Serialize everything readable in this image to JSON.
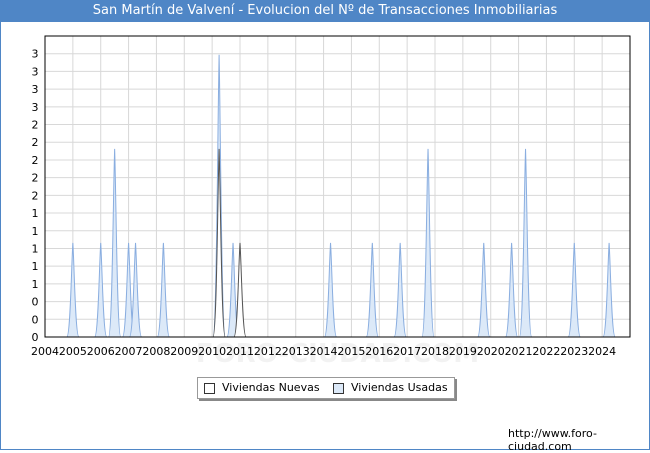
{
  "title": "San Martín de Valvení - Evolucion del Nº de Transacciones Inmobiliarias",
  "source": "http://www.foro-ciudad.com",
  "watermark": "FORO-CIUDAD.COM",
  "legend": [
    {
      "label": "Viviendas Nuevas",
      "color": "#ffffff"
    },
    {
      "label": "Viviendas Usadas",
      "color": "#dce9f8"
    }
  ],
  "chart_data": {
    "type": "area",
    "title": "San Martín de Valvení - Evolucion del Nº de Transacciones Inmobiliarias",
    "xlabel": "",
    "ylabel": "",
    "x_tick_labels": [
      "2004",
      "2005",
      "2006",
      "2007",
      "2008",
      "2009",
      "2010",
      "2011",
      "2012",
      "2013",
      "2014",
      "2015",
      "2016",
      "2017",
      "2018",
      "2019",
      "2020",
      "2021",
      "2022",
      "2023",
      "2024"
    ],
    "y_tick_labels": [
      "0",
      "0",
      "0",
      "1",
      "1",
      "1",
      "1",
      "1",
      "2",
      "2",
      "2",
      "2",
      "2",
      "3",
      "3",
      "3",
      "3"
    ],
    "ylim": [
      0,
      3.2
    ],
    "xlim": [
      2004.0,
      2025.0
    ],
    "grid": true,
    "legend_position": "bottom",
    "series": [
      {
        "name": "Viviendas Nuevas",
        "color": "#555555",
        "peaks": [
          {
            "x": 2010.25,
            "y": 2.0
          },
          {
            "x": 2011.0,
            "y": 1.0
          }
        ]
      },
      {
        "name": "Viviendas Usadas",
        "color": "#8aaee0",
        "peaks": [
          {
            "x": 2005.0,
            "y": 1.0
          },
          {
            "x": 2006.0,
            "y": 1.0
          },
          {
            "x": 2006.5,
            "y": 2.0
          },
          {
            "x": 2007.0,
            "y": 1.0
          },
          {
            "x": 2007.25,
            "y": 1.0
          },
          {
            "x": 2008.25,
            "y": 1.0
          },
          {
            "x": 2010.25,
            "y": 3.0
          },
          {
            "x": 2010.75,
            "y": 1.0
          },
          {
            "x": 2014.25,
            "y": 1.0
          },
          {
            "x": 2015.75,
            "y": 1.0
          },
          {
            "x": 2016.75,
            "y": 1.0
          },
          {
            "x": 2017.75,
            "y": 2.0
          },
          {
            "x": 2019.75,
            "y": 1.0
          },
          {
            "x": 2020.75,
            "y": 1.0
          },
          {
            "x": 2021.25,
            "y": 2.0
          },
          {
            "x": 2023.0,
            "y": 1.0
          },
          {
            "x": 2024.25,
            "y": 1.0
          }
        ]
      }
    ]
  }
}
